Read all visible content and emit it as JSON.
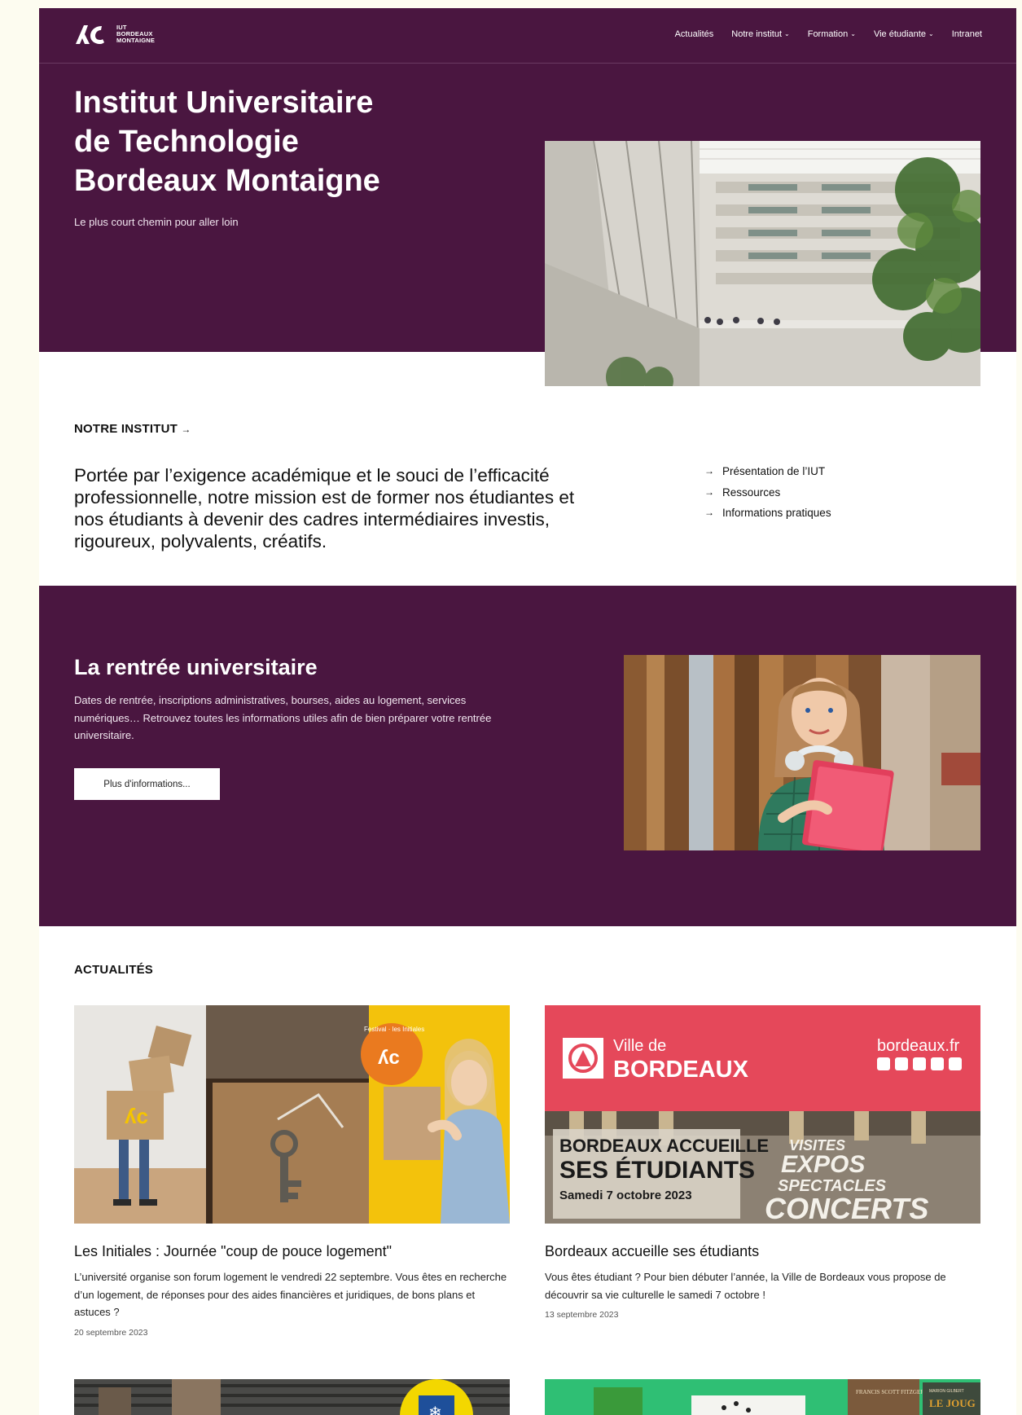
{
  "header": {
    "logo_lines": [
      "IUT",
      "BORDEAUX",
      "MONTAIGNE"
    ],
    "nav": [
      {
        "label": "Actualités",
        "dropdown": false
      },
      {
        "label": "Notre institut",
        "dropdown": true
      },
      {
        "label": "Formation",
        "dropdown": true
      },
      {
        "label": "Vie étudiante",
        "dropdown": true
      },
      {
        "label": "Intranet",
        "dropdown": false
      }
    ]
  },
  "hero": {
    "title_lines": [
      "Institut Universitaire",
      "de Technologie",
      "Bordeaux Montaigne"
    ],
    "subtitle": "Le plus court chemin pour aller loin"
  },
  "institut": {
    "label": "NOTRE INSTITUT",
    "mission": "Portée par l’exigence académique et le souci de l’efficacité professionnelle, notre mission est de former nos étudiantes et nos étudiants à devenir des cadres intermédiaires investis, rigoureux, polyvalents, créatifs.",
    "links": [
      "Présentation de l’IUT",
      "Ressources",
      "Informations pratiques"
    ]
  },
  "rentree": {
    "title": "La rentrée universitaire",
    "text": "Dates de rentrée, inscriptions administratives, bourses, aides au logement, services numériques… Retrouvez toutes les informations utiles afin de bien préparer votre rentrée universitaire.",
    "button": "Plus d'informations..."
  },
  "news": {
    "label": "ACTUALITÉS",
    "items": [
      {
        "title": "Les Initiales : Journée \"coup de pouce logement\"",
        "text": "L’université organise son forum logement le vendredi 22 septembre. Vous êtes en recherche d’un logement, de réponses pour des aides financières et juridiques, de bons plans et astuces ?",
        "date": "20 septembre 2023",
        "image_badge": "Festival · les Initiales"
      },
      {
        "title": "Bordeaux accueille ses étudiants",
        "text": "Vous êtes étudiant ? Pour bien débuter l’année, la Ville de Bordeaux vous propose de découvrir sa vie culturelle le samedi 7 octobre !",
        "date": "13 septembre 2023",
        "poster": {
          "ville": "Ville de",
          "city": "BORDEAUX",
          "site": "bordeaux.fr",
          "headline1": "BORDEAUX ACCUEILLE",
          "headline2": "SES ÉTUDIANTS",
          "headline3": "Samedi 7 octobre 2023",
          "right1": "VISITES",
          "right2": "EXPOS",
          "right3": "SPECTACLES",
          "right4": "CONCERTS"
        }
      }
    ],
    "partial_book_labels": [
      "FRANCIS SCOTT FITZGERALD",
      "MARION GILBERT",
      "LE JOUG"
    ]
  },
  "colors": {
    "primary": "#4a1640",
    "bordeaux_red": "#e5485a",
    "accent_yellow": "#f5c400",
    "accent_orange": "#ea7a1f"
  }
}
